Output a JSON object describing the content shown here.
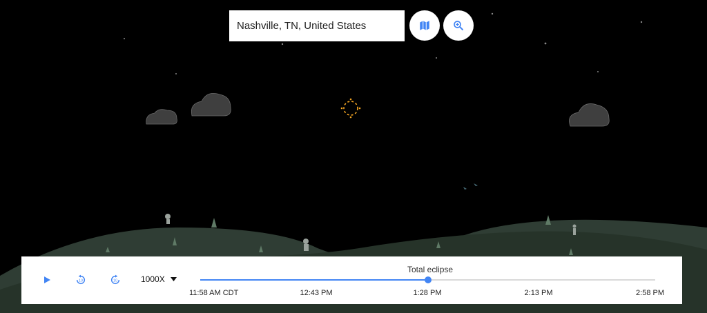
{
  "search": {
    "location": "Nashville, TN, United States"
  },
  "icons": {
    "map": "map-icon",
    "zoom": "zoom-in-icon",
    "play": "play-icon",
    "rewind": "replay-10-icon",
    "forward": "forward-10-icon",
    "dropdown": "caret-down-icon"
  },
  "controls": {
    "speed_label": "1000X",
    "event_label": "Total eclipse",
    "progress": 0.5,
    "rewind_badge": "10",
    "forward_badge": "10"
  },
  "timeline": {
    "ticks": [
      "11:58 AM CDT",
      "12:43 PM",
      "1:28 PM",
      "2:13 PM",
      "2:58 PM"
    ]
  },
  "colors": {
    "accent": "#4285f4",
    "sky": "#000000",
    "hills": "#2f3d34",
    "corona": "#f5a623"
  }
}
